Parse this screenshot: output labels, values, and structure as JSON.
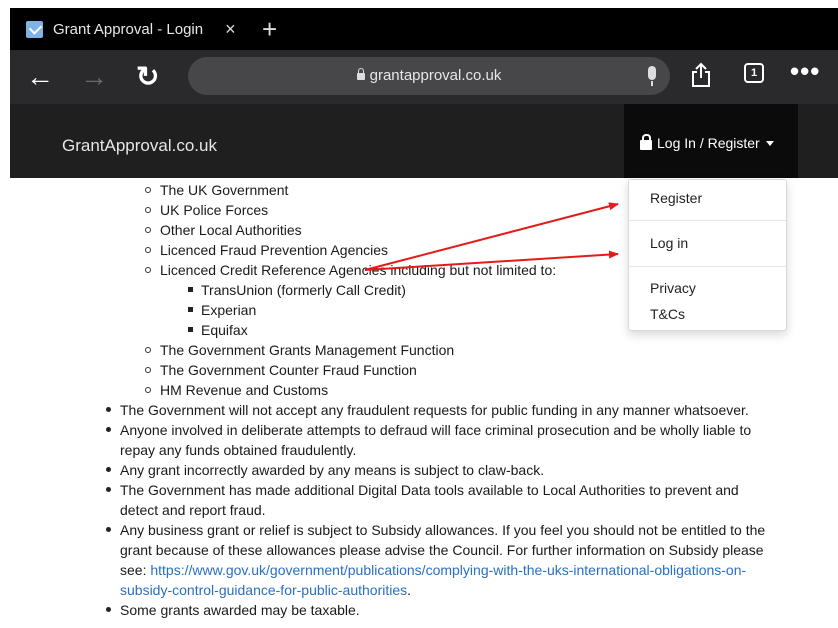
{
  "browser": {
    "tab_title": "Grant Approval - Login",
    "tab_close": "×",
    "new_tab": "+",
    "url": "grantapproval.co.uk",
    "tab_count": "1",
    "more": "•••"
  },
  "site": {
    "brand": "GrantApproval.co.uk",
    "login_toggle": "Log In / Register"
  },
  "dropdown": {
    "items": [
      "Register",
      "Log in",
      "Privacy",
      "T&Cs"
    ]
  },
  "content": {
    "sub_items": [
      "The UK Government",
      "UK Police Forces",
      "Other Local Authorities",
      "Licenced Fraud Prevention Agencies",
      "Licenced Credit Reference Agencies including but not limited to:"
    ],
    "subsub_items": [
      "TransUnion (formerly Call Credit)",
      "Experian",
      "Equifax"
    ],
    "sub_items_2": [
      "The Government Grants Management Function",
      "The Government Counter Fraud Function",
      "HM Revenue and Customs"
    ],
    "bullets": {
      "b1": "The Government will not accept any fraudulent requests for public funding in any manner whatsoever.",
      "b2_l1": "Anyone involved in deliberate attempts to defraud will face criminal prosecution and be wholly liable to",
      "b2_l2": "repay any funds obtained fraudulently.",
      "b3": "Any grant incorrectly awarded by any means is subject to claw-back.",
      "b4_l1": "The Government has made additional Digital Data tools available to Local Authorities to prevent and",
      "b4_l2": "detect and report fraud.",
      "b5_l1": "Any business grant or relief is subject to Subsidy allowances. If you feel you should not be entitled to the",
      "b5_l2": "grant because of these allowances please advise the Council. For further information on Subsidy please",
      "b5_l3_prefix": "see: ",
      "b5_link_l1": "https://www.gov.uk/government/publications/complying-with-the-uks-international-obligations-on-",
      "b5_link_l2": "subsidy-control-guidance-for-public-authorities",
      "b5_l4_suffix": ".",
      "b6": "Some grants awarded may be taxable."
    }
  },
  "colors": {
    "arrow": "#e31b1b",
    "link": "#2a6fc0",
    "header_bg": "#1f1f1f"
  }
}
